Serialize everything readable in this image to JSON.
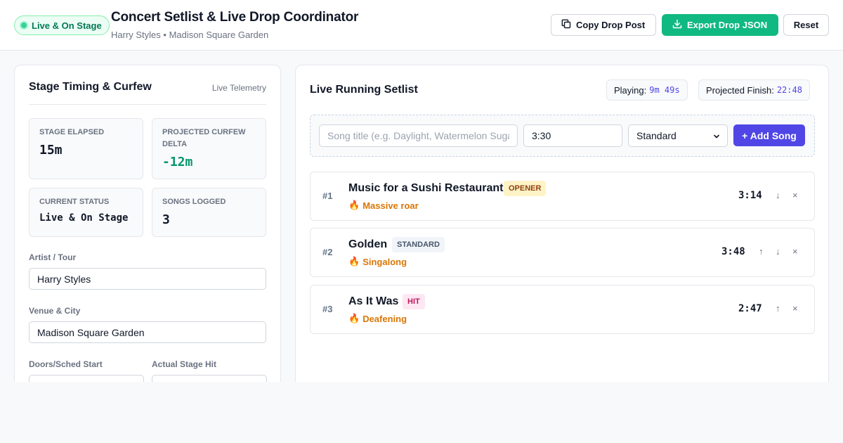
{
  "header": {
    "status_pill": "Live & On Stage",
    "title": "Concert Setlist & Live Drop Coordinator",
    "subtitle": "Harry Styles • Madison Square Garden",
    "copy_label": "Copy Drop Post",
    "export_label": "Export Drop JSON",
    "reset_label": "Reset"
  },
  "timing": {
    "title": "Stage Timing & Curfew",
    "subtitle": "Live Telemetry",
    "stats": [
      {
        "label": "Stage Elapsed",
        "value": "15m"
      },
      {
        "label": "Projected Curfew Delta",
        "value": "-12m"
      },
      {
        "label": "Current Status",
        "value": "Live & On Stage"
      },
      {
        "label": "Songs Logged",
        "value": "3"
      }
    ],
    "fields": [
      {
        "label": "Artist / Tour",
        "value": "Harry Styles"
      },
      {
        "label": "Venue & City",
        "value": "Madison Square Garden"
      },
      {
        "label": "Doors/Sched Start",
        "value": ""
      },
      {
        "label": "Actual Stage Hit",
        "value": ""
      }
    ]
  },
  "setlist": {
    "title": "Live Running Setlist",
    "playing_label": "Playing:",
    "playing_value": "9m 49s",
    "finish_label": "Projected Finish:",
    "finish_value": "22:48",
    "add_form": {
      "title_placeholder": "Song title (e.g. Daylight, Watermelon Sugar)",
      "duration_value": "3:30",
      "type_value": "Standard",
      "add_label": "+ Add Song"
    },
    "songs": [
      {
        "num": "#1",
        "title": "Music for a Sushi Restaurant",
        "badge": "OPENER",
        "crowd": "Massive roar",
        "duration": "3:14"
      },
      {
        "num": "#2",
        "title": "Golden",
        "badge": "STANDARD",
        "crowd": "Singalong",
        "duration": "3:48"
      },
      {
        "num": "#3",
        "title": "As It Was",
        "badge": "HIT",
        "crowd": "Deafening",
        "duration": "2:47"
      }
    ],
    "controls": {
      "up": "↑",
      "down": "↓",
      "remove": "×"
    }
  },
  "icons": {
    "fire": "fire-icon"
  },
  "colors": {
    "accent_green": "#10b981",
    "accent_indigo": "#4f46e5",
    "curfew_delta": "#059669",
    "crowd": "#d97706"
  }
}
